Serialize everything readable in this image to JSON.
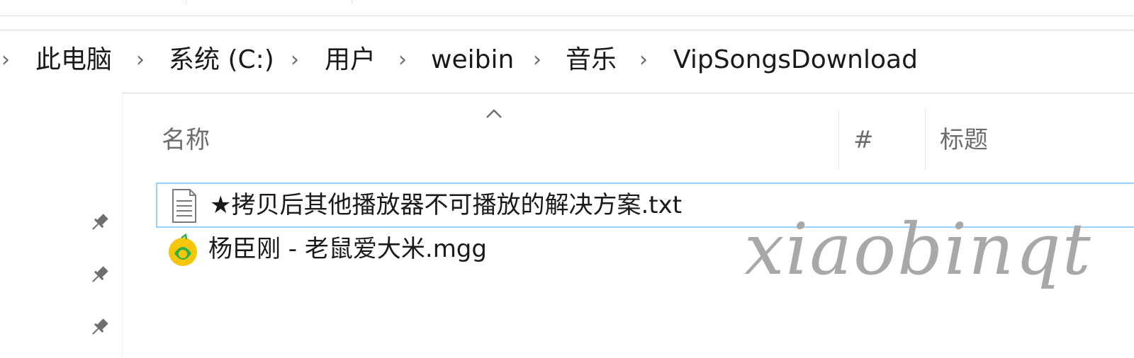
{
  "breadcrumb": {
    "items": [
      "此电脑",
      "系统 (C:)",
      "用户",
      "weibin",
      "音乐",
      "VipSongsDownload"
    ],
    "separator": "›"
  },
  "columns": {
    "name": "名称",
    "number": "#",
    "title": "标题"
  },
  "files": [
    {
      "name": "★拷贝后其他播放器不可播放的解决方案.txt",
      "icon": "text-file-icon",
      "selected": true
    },
    {
      "name": "杨臣刚 - 老鼠爱大米.mgg",
      "icon": "qq-music-file-icon",
      "selected": false
    }
  ],
  "watermark": "xiaobinqt",
  "colors": {
    "selection_border": "#99d1ff",
    "qq_music_yellow": "#f5c60a",
    "qq_music_green": "#2cb04a",
    "header_text": "#6d6d6d"
  }
}
